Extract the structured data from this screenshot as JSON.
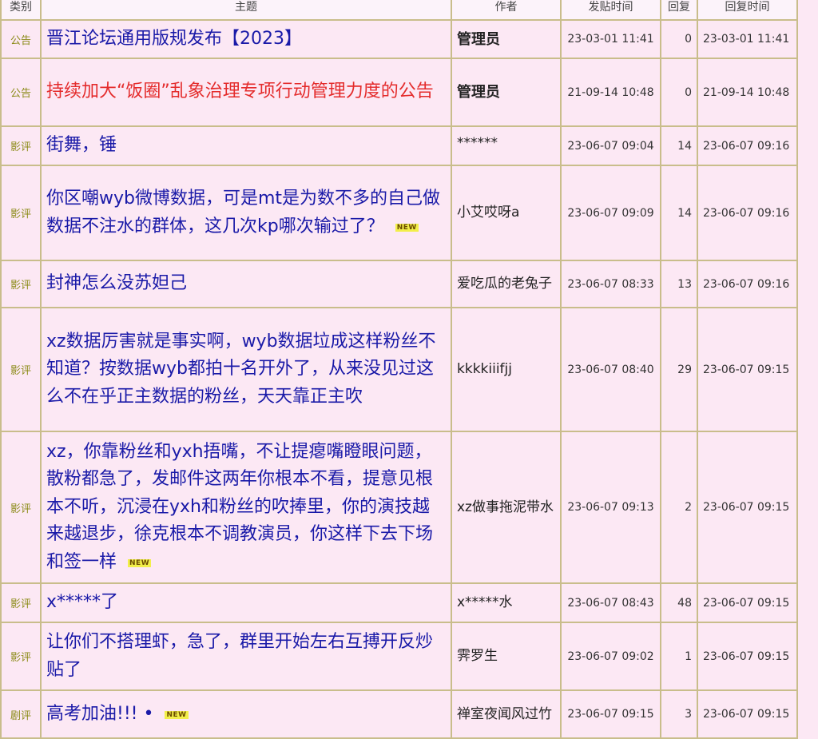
{
  "columns": {
    "category": "类别",
    "subject": "主题",
    "author": "作者",
    "post_time": "发贴时间",
    "replies": "回复",
    "reply_time": "回复时间"
  },
  "new_label": "NEW",
  "colors": {
    "background": "#fce8f4",
    "border": "#c9bd8b",
    "link": "#1a1aa8",
    "announcement_red": "#e42b2b",
    "category_text": "#8a8a16",
    "new_badge": "#f2ef4a"
  },
  "rows": [
    {
      "category": "公告",
      "subject": "晋江论坛通用版规发布【2023】",
      "author": "管理员",
      "post_time": "23-03-01 11:41",
      "replies": "0",
      "reply_time": "23-03-01 11:41"
    },
    {
      "category": "公告",
      "subject": "持续加大“饭圈”乱象治理专项行动管理力度的公告",
      "author": "管理员",
      "post_time": "21-09-14 10:48",
      "replies": "0",
      "reply_time": "21-09-14 10:48"
    },
    {
      "category": "影评",
      "subject": "街舞，锤",
      "author": "******",
      "post_time": "23-06-07 09:04",
      "replies": "14",
      "reply_time": "23-06-07 09:16"
    },
    {
      "category": "影评",
      "subject": "你区嘲wyb微博数据，可是mt是为数不多的自己做数据不注水的群体，这几次kp哪次输过了？",
      "author": "小艾哎呀a",
      "post_time": "23-06-07 09:09",
      "replies": "14",
      "reply_time": "23-06-07 09:16"
    },
    {
      "category": "影评",
      "subject": "封神怎么没苏妲己",
      "author": "爱吃瓜的老兔子",
      "post_time": "23-06-07 08:33",
      "replies": "13",
      "reply_time": "23-06-07 09:16"
    },
    {
      "category": "影评",
      "subject": "xz数据厉害就是事实啊，wyb数据垃成这样粉丝不知道？按数据wyb都拍十名开外了，从来没见过这么不在乎正主数据的粉丝，天天靠正主吹",
      "author": "kkkkiiifjj",
      "post_time": "23-06-07 08:40",
      "replies": "29",
      "reply_time": "23-06-07 09:15"
    },
    {
      "category": "影评",
      "subject": "xz，你靠粉丝和yxh捂嘴，不让提瘪嘴瞪眼问题，散粉都急了，发邮件这两年你根本不看，提意见根本不听，沉浸在yxh和粉丝的吹捧里，你的演技越来越退步，徐克根本不调教演员，你这样下去下场和签一样",
      "author": "xz做事拖泥带水",
      "post_time": "23-06-07 09:13",
      "replies": "2",
      "reply_time": "23-06-07 09:15"
    },
    {
      "category": "影评",
      "subject": "x*****了",
      "author": "x*****水",
      "post_time": "23-06-07 08:43",
      "replies": "48",
      "reply_time": "23-06-07 09:15"
    },
    {
      "category": "影评",
      "subject": "让你们不搭理虾，急了，群里开始左右互搏开反炒贴了",
      "author": "霁罗生",
      "post_time": "23-06-07 09:02",
      "replies": "1",
      "reply_time": "23-06-07 09:15"
    },
    {
      "category": "剧评",
      "subject": "高考加油!!! •",
      "author": "禅室夜闻风过竹",
      "post_time": "23-06-07 09:15",
      "replies": "3",
      "reply_time": "23-06-07 09:15"
    }
  ]
}
